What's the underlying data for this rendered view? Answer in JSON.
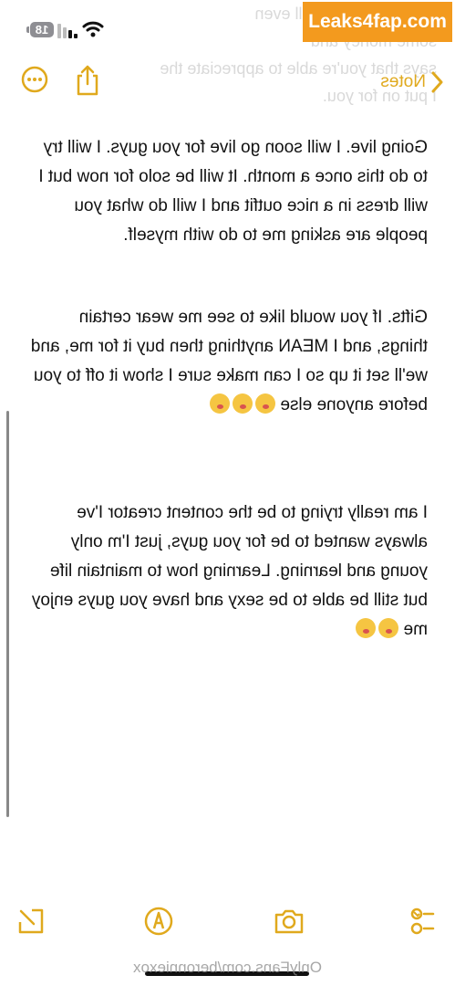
{
  "status_bar": {
    "battery": "18",
    "wifi_icon": "wifi-icon",
    "signal_icon": "signal-icon"
  },
  "nav": {
    "back_label": "Notes",
    "back_icon": "chevron-left-icon",
    "share_icon": "share-icon",
    "more_icon": "more-icon"
  },
  "ghost_text": "see more and you'll even\nsome money and\nsays that you're able to appreciate the\nI put on for you.",
  "note": {
    "paragraphs": [
      "Going live. I will soon go live for you guys. I will try to do this once a month. It will be solo for now but I will dress in a nice outfit and I will do what you people are asking me to do with myself.",
      "Gifts. If you would like to see me wear certain things, and I MEAN anything then buy it for me, and we'll set it up so I can make sure I show it off to you before anyone else",
      "I am really trying to be the content creator I've always wanted to be for you guys, just I'm only young and learning. Learning how to maintain life but still be able to be sexy and have you guys enjoy me"
    ]
  },
  "toolbar": {
    "checklist_icon": "checklist-icon",
    "camera_icon": "camera-icon",
    "markup_icon": "markup-icon",
    "compose_icon": "compose-icon"
  },
  "watermark": {
    "bottom": "OnlyFans.com/beronniexox",
    "badge": "Leaks4fap.com"
  },
  "colors": {
    "accent": "#e0a91d",
    "text": "#111111",
    "badge": "#f39a1e"
  }
}
